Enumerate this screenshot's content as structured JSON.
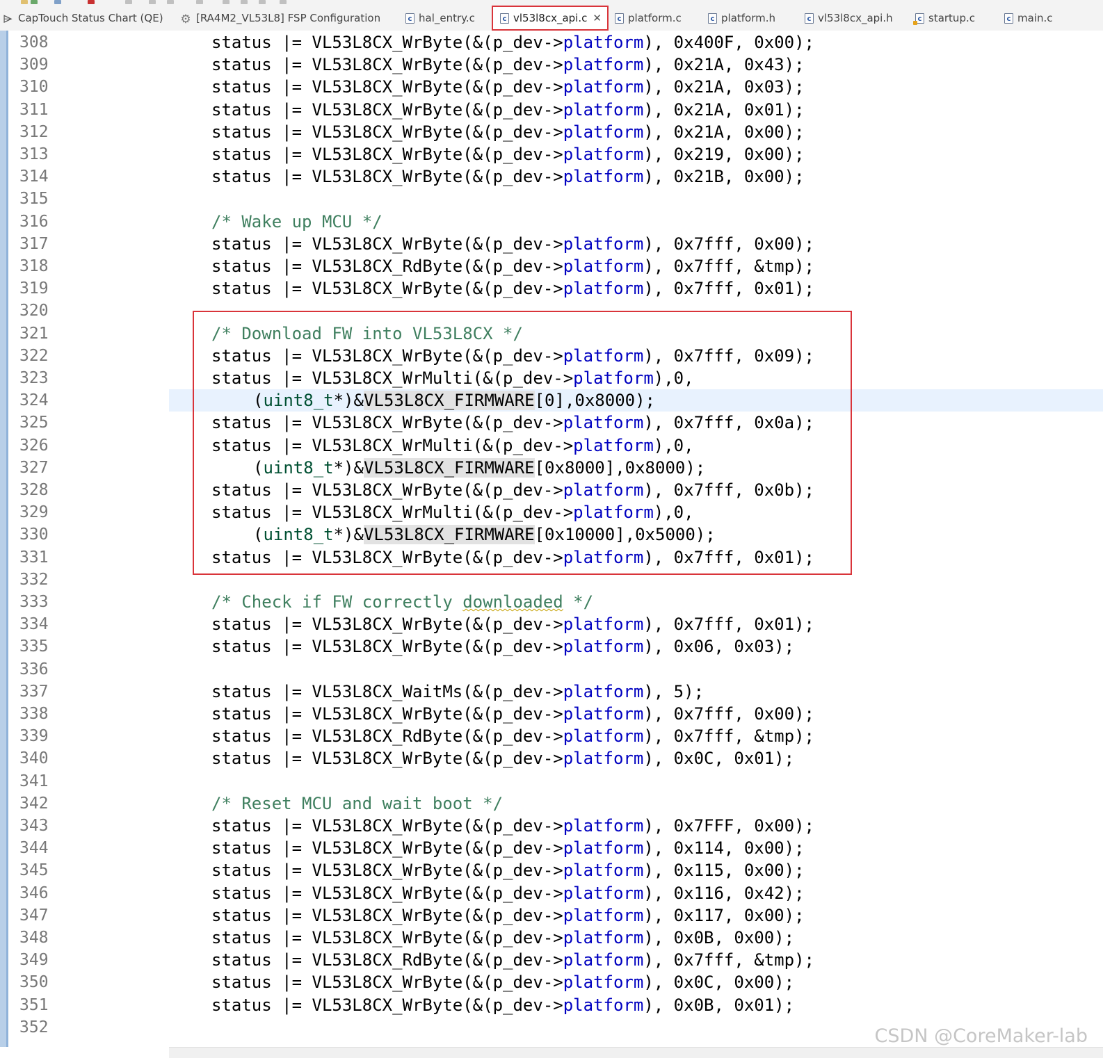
{
  "colors": {
    "tab_highlight": "#d9343a",
    "comment": "#3f7f5f",
    "field": "#0000c0",
    "type": "#005032",
    "current_line": "#e8f2fe"
  },
  "tabs": [
    {
      "label": "CapTouch Status Chart (QE)",
      "icon": "qe-chart-icon",
      "active": false
    },
    {
      "label": "[RA4M2_VL53L8] FSP Configuration",
      "icon": "gear-icon",
      "active": false
    },
    {
      "label": "hal_entry.c",
      "icon": "c-file-icon",
      "active": false
    },
    {
      "label": "vl53l8cx_api.c",
      "icon": "c-file-icon",
      "active": true
    },
    {
      "label": "platform.c",
      "icon": "c-file-icon",
      "active": false
    },
    {
      "label": "platform.h",
      "icon": "c-file-icon",
      "active": false
    },
    {
      "label": "vl53l8cx_api.h",
      "icon": "c-file-icon",
      "active": false
    },
    {
      "label": "startup.c",
      "icon": "c-file-warning-icon",
      "active": false
    },
    {
      "label": "main.c",
      "icon": "c-file-icon",
      "active": false
    }
  ],
  "code_lines": [
    {
      "n": "308",
      "indent": 1,
      "seg": [
        [
          "status |= VL53L8CX_WrByte(&(p_dev->",
          ""
        ],
        [
          "platform",
          "field"
        ],
        [
          "), 0x400F, 0x00);",
          ""
        ]
      ]
    },
    {
      "n": "309",
      "indent": 1,
      "seg": [
        [
          "status |= VL53L8CX_WrByte(&(p_dev->",
          ""
        ],
        [
          "platform",
          "field"
        ],
        [
          "), 0x21A, 0x43);",
          ""
        ]
      ]
    },
    {
      "n": "310",
      "indent": 1,
      "seg": [
        [
          "status |= VL53L8CX_WrByte(&(p_dev->",
          ""
        ],
        [
          "platform",
          "field"
        ],
        [
          "), 0x21A, 0x03);",
          ""
        ]
      ]
    },
    {
      "n": "311",
      "indent": 1,
      "seg": [
        [
          "status |= VL53L8CX_WrByte(&(p_dev->",
          ""
        ],
        [
          "platform",
          "field"
        ],
        [
          "), 0x21A, 0x01);",
          ""
        ]
      ]
    },
    {
      "n": "312",
      "indent": 1,
      "seg": [
        [
          "status |= VL53L8CX_WrByte(&(p_dev->",
          ""
        ],
        [
          "platform",
          "field"
        ],
        [
          "), 0x21A, 0x00);",
          ""
        ]
      ]
    },
    {
      "n": "313",
      "indent": 1,
      "seg": [
        [
          "status |= VL53L8CX_WrByte(&(p_dev->",
          ""
        ],
        [
          "platform",
          "field"
        ],
        [
          "), 0x219, 0x00);",
          ""
        ]
      ]
    },
    {
      "n": "314",
      "indent": 1,
      "seg": [
        [
          "status |= VL53L8CX_WrByte(&(p_dev->",
          ""
        ],
        [
          "platform",
          "field"
        ],
        [
          "), 0x21B, 0x00);",
          ""
        ]
      ]
    },
    {
      "n": "315",
      "indent": 1,
      "seg": []
    },
    {
      "n": "316",
      "indent": 1,
      "seg": [
        [
          "/* Wake up MCU */",
          "comment"
        ]
      ]
    },
    {
      "n": "317",
      "indent": 1,
      "seg": [
        [
          "status |= VL53L8CX_WrByte(&(p_dev->",
          ""
        ],
        [
          "platform",
          "field"
        ],
        [
          "), 0x7fff, 0x00);",
          ""
        ]
      ]
    },
    {
      "n": "318",
      "indent": 1,
      "seg": [
        [
          "status |= VL53L8CX_RdByte(&(p_dev->",
          ""
        ],
        [
          "platform",
          "field"
        ],
        [
          "), 0x7fff, &tmp);",
          ""
        ]
      ]
    },
    {
      "n": "319",
      "indent": 1,
      "seg": [
        [
          "status |= VL53L8CX_WrByte(&(p_dev->",
          ""
        ],
        [
          "platform",
          "field"
        ],
        [
          "), 0x7fff, 0x01);",
          ""
        ]
      ]
    },
    {
      "n": "320",
      "indent": 1,
      "seg": []
    },
    {
      "n": "321",
      "indent": 1,
      "seg": [
        [
          "/* Download FW into VL53L8CX */",
          "comment"
        ]
      ]
    },
    {
      "n": "322",
      "indent": 1,
      "seg": [
        [
          "status |= VL53L8CX_WrByte(&(p_dev->",
          ""
        ],
        [
          "platform",
          "field"
        ],
        [
          "), 0x7fff, 0x09);",
          ""
        ]
      ]
    },
    {
      "n": "323",
      "indent": 1,
      "seg": [
        [
          "status |= VL53L8CX_WrMulti(&(p_dev->",
          ""
        ],
        [
          "platform",
          "field"
        ],
        [
          "),0,",
          ""
        ]
      ]
    },
    {
      "n": "324",
      "indent": 2,
      "current": true,
      "seg": [
        [
          "(",
          ""
        ],
        [
          "uint8_t",
          "type"
        ],
        [
          "*)&",
          ""
        ],
        [
          "VL53L8CX_FIRMWARE",
          "hl"
        ],
        [
          "[0],0x8000);",
          ""
        ]
      ]
    },
    {
      "n": "325",
      "indent": 1,
      "seg": [
        [
          "status |= VL53L8CX_WrByte(&(p_dev->",
          ""
        ],
        [
          "platform",
          "field"
        ],
        [
          "), 0x7fff, 0x0a);",
          ""
        ]
      ]
    },
    {
      "n": "326",
      "indent": 1,
      "seg": [
        [
          "status |= VL53L8CX_WrMulti(&(p_dev->",
          ""
        ],
        [
          "platform",
          "field"
        ],
        [
          "),0,",
          ""
        ]
      ]
    },
    {
      "n": "327",
      "indent": 2,
      "seg": [
        [
          "(",
          ""
        ],
        [
          "uint8_t",
          "type"
        ],
        [
          "*)&",
          ""
        ],
        [
          "VL53L8CX_FIRMWARE",
          "hl"
        ],
        [
          "[0x8000],0x8000);",
          ""
        ]
      ]
    },
    {
      "n": "328",
      "indent": 1,
      "seg": [
        [
          "status |= VL53L8CX_WrByte(&(p_dev->",
          ""
        ],
        [
          "platform",
          "field"
        ],
        [
          "), 0x7fff, 0x0b);",
          ""
        ]
      ]
    },
    {
      "n": "329",
      "indent": 1,
      "seg": [
        [
          "status |= VL53L8CX_WrMulti(&(p_dev->",
          ""
        ],
        [
          "platform",
          "field"
        ],
        [
          "),0,",
          ""
        ]
      ]
    },
    {
      "n": "330",
      "indent": 2,
      "seg": [
        [
          "(",
          ""
        ],
        [
          "uint8_t",
          "type"
        ],
        [
          "*)&",
          ""
        ],
        [
          "VL53L8CX_FIRMWARE",
          "hl"
        ],
        [
          "[0x10000],0x5000);",
          ""
        ]
      ]
    },
    {
      "n": "331",
      "indent": 1,
      "seg": [
        [
          "status |= VL53L8CX_WrByte(&(p_dev->",
          ""
        ],
        [
          "platform",
          "field"
        ],
        [
          "), 0x7fff, 0x01);",
          ""
        ]
      ]
    },
    {
      "n": "332",
      "indent": 1,
      "seg": []
    },
    {
      "n": "333",
      "indent": 1,
      "seg": [
        [
          "/* Check if FW correctly ",
          "comment"
        ],
        [
          "downloaded",
          "comment-squiggle"
        ],
        [
          " */",
          "comment"
        ]
      ]
    },
    {
      "n": "334",
      "indent": 1,
      "seg": [
        [
          "status |= VL53L8CX_WrByte(&(p_dev->",
          ""
        ],
        [
          "platform",
          "field"
        ],
        [
          "), 0x7fff, 0x01);",
          ""
        ]
      ]
    },
    {
      "n": "335",
      "indent": 1,
      "seg": [
        [
          "status |= VL53L8CX_WrByte(&(p_dev->",
          ""
        ],
        [
          "platform",
          "field"
        ],
        [
          "), 0x06, 0x03);",
          ""
        ]
      ]
    },
    {
      "n": "336",
      "indent": 1,
      "seg": []
    },
    {
      "n": "337",
      "indent": 1,
      "seg": [
        [
          "status |= VL53L8CX_WaitMs(&(p_dev->",
          ""
        ],
        [
          "platform",
          "field"
        ],
        [
          "), 5);",
          ""
        ]
      ]
    },
    {
      "n": "338",
      "indent": 1,
      "seg": [
        [
          "status |= VL53L8CX_WrByte(&(p_dev->",
          ""
        ],
        [
          "platform",
          "field"
        ],
        [
          "), 0x7fff, 0x00);",
          ""
        ]
      ]
    },
    {
      "n": "339",
      "indent": 1,
      "seg": [
        [
          "status |= VL53L8CX_RdByte(&(p_dev->",
          ""
        ],
        [
          "platform",
          "field"
        ],
        [
          "), 0x7fff, &tmp);",
          ""
        ]
      ]
    },
    {
      "n": "340",
      "indent": 1,
      "seg": [
        [
          "status |= VL53L8CX_WrByte(&(p_dev->",
          ""
        ],
        [
          "platform",
          "field"
        ],
        [
          "), 0x0C, 0x01);",
          ""
        ]
      ]
    },
    {
      "n": "341",
      "indent": 1,
      "seg": []
    },
    {
      "n": "342",
      "indent": 1,
      "seg": [
        [
          "/* Reset MCU and wait boot */",
          "comment"
        ]
      ]
    },
    {
      "n": "343",
      "indent": 1,
      "seg": [
        [
          "status |= VL53L8CX_WrByte(&(p_dev->",
          ""
        ],
        [
          "platform",
          "field"
        ],
        [
          "), 0x7FFF, 0x00);",
          ""
        ]
      ]
    },
    {
      "n": "344",
      "indent": 1,
      "seg": [
        [
          "status |= VL53L8CX_WrByte(&(p_dev->",
          ""
        ],
        [
          "platform",
          "field"
        ],
        [
          "), 0x114, 0x00);",
          ""
        ]
      ]
    },
    {
      "n": "345",
      "indent": 1,
      "seg": [
        [
          "status |= VL53L8CX_WrByte(&(p_dev->",
          ""
        ],
        [
          "platform",
          "field"
        ],
        [
          "), 0x115, 0x00);",
          ""
        ]
      ]
    },
    {
      "n": "346",
      "indent": 1,
      "seg": [
        [
          "status |= VL53L8CX_WrByte(&(p_dev->",
          ""
        ],
        [
          "platform",
          "field"
        ],
        [
          "), 0x116, 0x42);",
          ""
        ]
      ]
    },
    {
      "n": "347",
      "indent": 1,
      "seg": [
        [
          "status |= VL53L8CX_WrByte(&(p_dev->",
          ""
        ],
        [
          "platform",
          "field"
        ],
        [
          "), 0x117, 0x00);",
          ""
        ]
      ]
    },
    {
      "n": "348",
      "indent": 1,
      "seg": [
        [
          "status |= VL53L8CX_WrByte(&(p_dev->",
          ""
        ],
        [
          "platform",
          "field"
        ],
        [
          "), 0x0B, 0x00);",
          ""
        ]
      ]
    },
    {
      "n": "349",
      "indent": 1,
      "seg": [
        [
          "status |= VL53L8CX_RdByte(&(p_dev->",
          ""
        ],
        [
          "platform",
          "field"
        ],
        [
          "), 0x7fff, &tmp);",
          ""
        ]
      ]
    },
    {
      "n": "350",
      "indent": 1,
      "seg": [
        [
          "status |= VL53L8CX_WrByte(&(p_dev->",
          ""
        ],
        [
          "platform",
          "field"
        ],
        [
          "), 0x0C, 0x00);",
          ""
        ]
      ]
    },
    {
      "n": "351",
      "indent": 1,
      "seg": [
        [
          "status |= VL53L8CX_WrByte(&(p_dev->",
          ""
        ],
        [
          "platform",
          "field"
        ],
        [
          "), 0x0B, 0x01);",
          ""
        ]
      ]
    },
    {
      "n": "352",
      "indent": 1,
      "seg": []
    }
  ],
  "watermark": "CSDN @CoreMaker-lab"
}
